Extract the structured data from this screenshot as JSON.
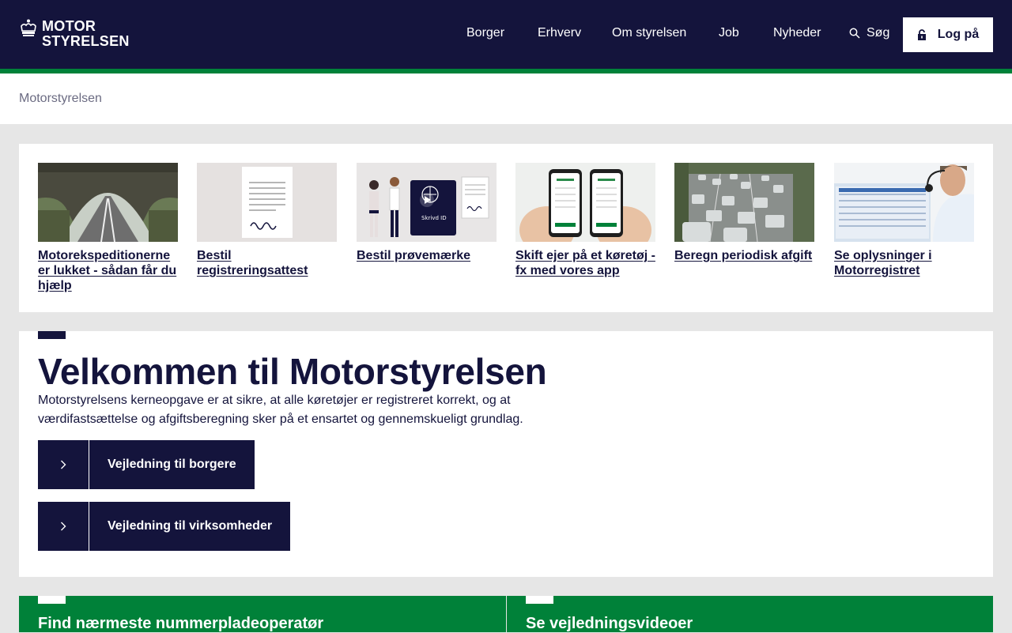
{
  "header": {
    "logo_line1": "MOTOR",
    "logo_line2": "STYRELSEN",
    "nav": [
      "Borger",
      "Erhverv",
      "Om styrelsen",
      "Job",
      "Nyheder"
    ],
    "search_label": "Søg",
    "login_label": "Log på"
  },
  "breadcrumb": "Motorstyrelsen",
  "cards": [
    {
      "title": "Motorekspeditionerne er lukket - sådan får du hjælp",
      "icon": "road-tunnel-photo"
    },
    {
      "title": "Bestil registreringsattest",
      "icon": "document-illustration"
    },
    {
      "title": "Bestil prøvemærke",
      "icon": "people-passport-illustration",
      "video_label": "Skrivd ID"
    },
    {
      "title": "Skift ejer på et køretøj - fx med vores app",
      "icon": "phones-photo"
    },
    {
      "title": "Beregn periodisk afgift",
      "icon": "highway-traffic-photo"
    },
    {
      "title": "Se oplysninger i Motorregistret",
      "icon": "operator-headset-photo"
    }
  ],
  "welcome": {
    "title": "Velkommen til Motorstyrelsen",
    "text": "Motorstyrelsens kerneopgave er at sikre, at alle køretøjer er registreret korrekt, og at værdifastsættelse og afgiftsberegning sker på et ensartet og gennemskueligt grundlag.",
    "buttons": [
      "Vejledning til borgere",
      "Vejledning til virksomheder"
    ]
  },
  "promos": [
    "Find nærmeste nummerpladeoperatør",
    "Se vejledningsvideoer"
  ],
  "colors": {
    "navy": "#14143c",
    "green": "#008139",
    "background": "#e6e6e6"
  }
}
